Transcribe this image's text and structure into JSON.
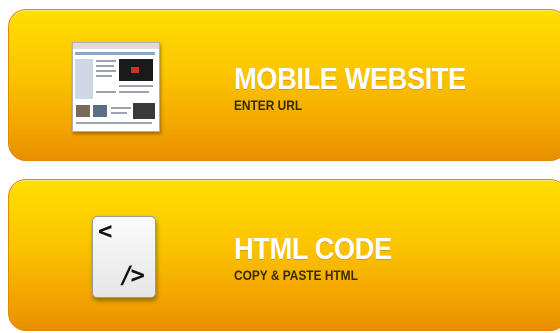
{
  "options": [
    {
      "title": "MOBILE WEBSITE",
      "subtitle": "ENTER URL",
      "icon": "website-thumbnail-icon"
    },
    {
      "title": "HTML CODE",
      "subtitle": "COPY & PASTE HTML",
      "icon": "code-file-icon",
      "icon_text_open": "<",
      "icon_text_close": "/>"
    }
  ],
  "colors": {
    "button_top": "#ffdf00",
    "button_bottom": "#e88f00",
    "title": "#ffffff",
    "subtitle": "#3a2a00"
  }
}
